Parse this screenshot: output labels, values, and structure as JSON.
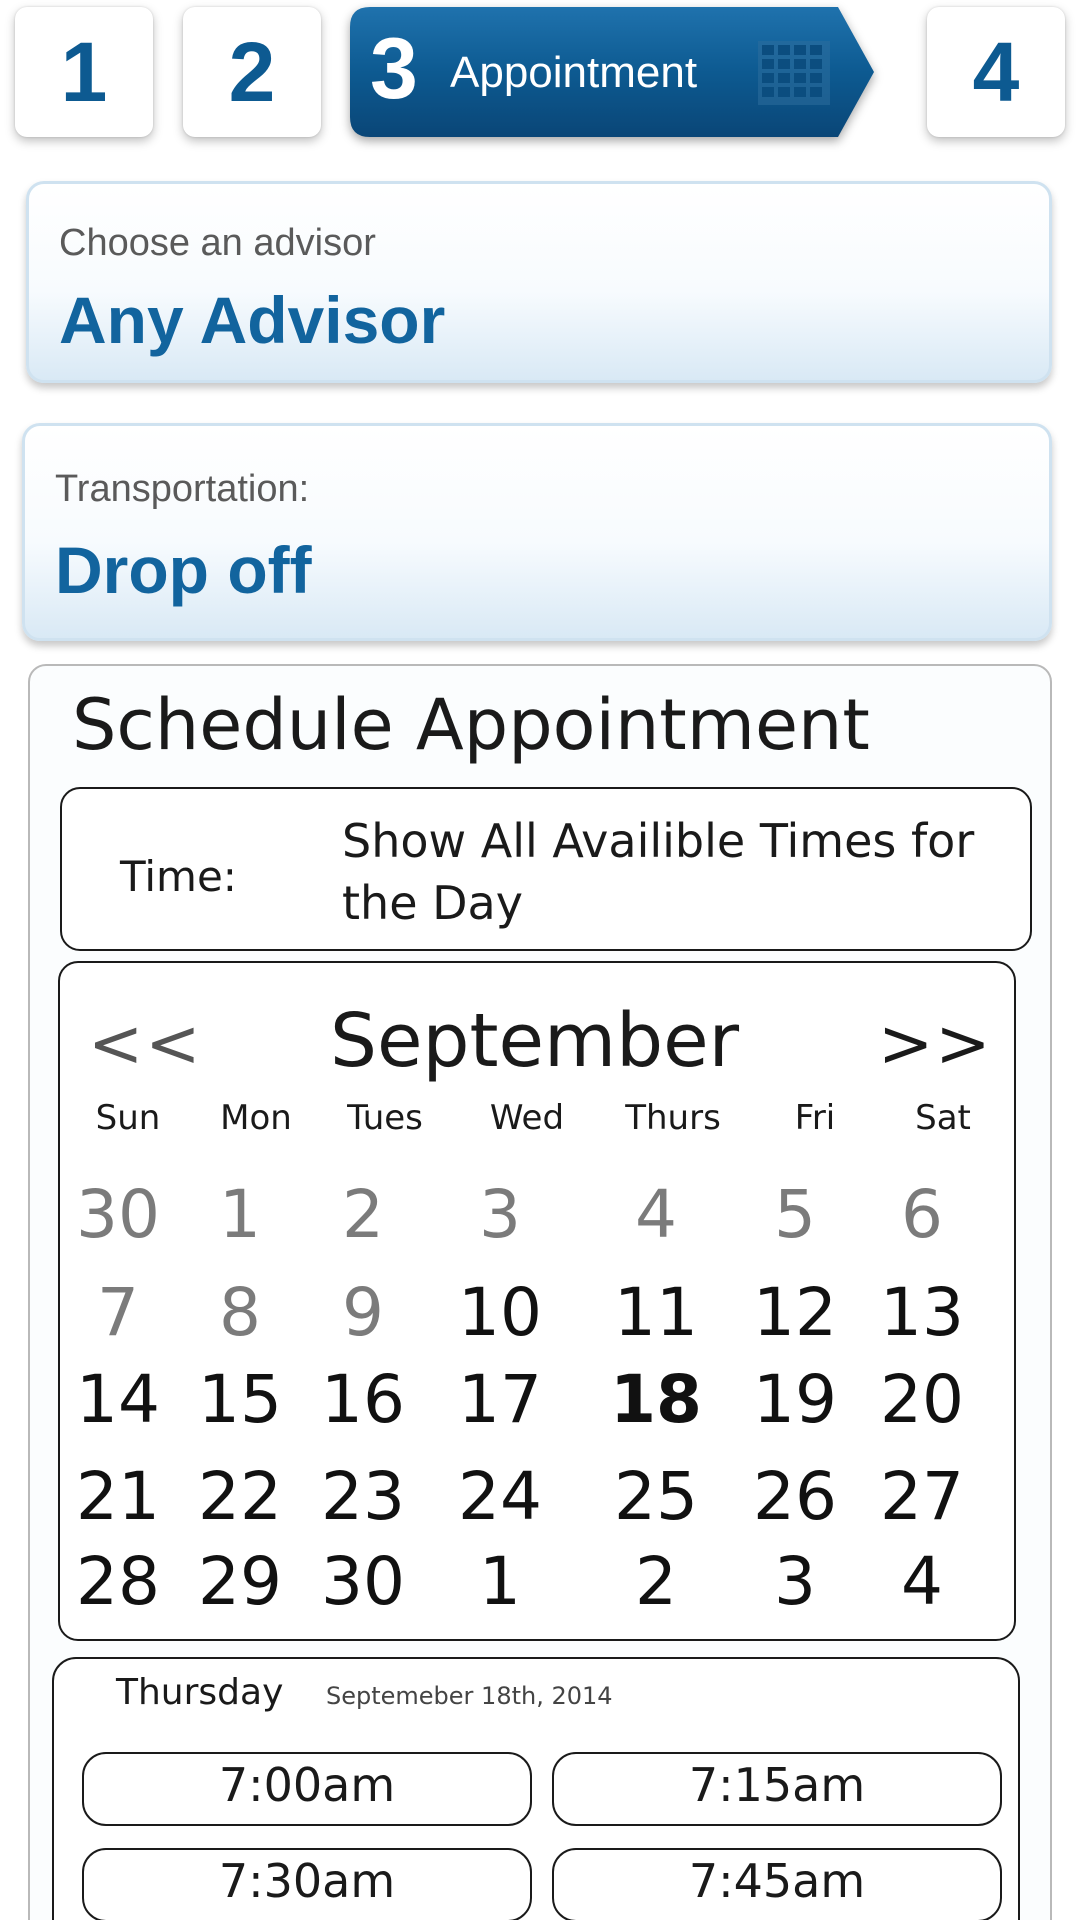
{
  "steps": {
    "step1": "1",
    "step2": "2",
    "active_number": "3",
    "active_label": "Appointment",
    "active_icon": "calendar-grid-icon",
    "step4": "4"
  },
  "colors": {
    "brand_blue": "#0d5a91",
    "brand_dark": "#0a4677",
    "panel_border": "#cfe2f0"
  },
  "advisor": {
    "caption": "Choose an advisor",
    "value": "Any Advisor"
  },
  "transport": {
    "caption": "Transportation:",
    "value": "Drop off"
  },
  "schedule": {
    "title": "Schedule Appointment",
    "time_label": "Time:",
    "time_value": "Show All Availible Times for the Day"
  },
  "calendar": {
    "prev": "<<",
    "next": ">>",
    "month": "September",
    "weekdays": [
      "Sun",
      "Mon",
      "Tues",
      "Wed",
      "Thurs",
      "Fri",
      "Sat"
    ],
    "weeks": [
      [
        "30",
        "1",
        "2",
        "3",
        "4",
        "5",
        "6"
      ],
      [
        "7",
        "8",
        "9",
        "10",
        "11",
        "12",
        "13"
      ],
      [
        "14",
        "15",
        "16",
        "17",
        "18",
        "19",
        "20"
      ],
      [
        "21",
        "22",
        "23",
        "24",
        "25",
        "26",
        "27"
      ],
      [
        "28",
        "29",
        "30",
        "1",
        "2",
        "3",
        "4"
      ]
    ],
    "unavailable": [
      [
        true,
        true,
        true,
        true,
        true,
        true,
        true
      ],
      [
        true,
        true,
        true,
        false,
        false,
        false,
        false
      ],
      [
        false,
        false,
        false,
        false,
        false,
        false,
        false
      ],
      [
        false,
        false,
        false,
        false,
        false,
        false,
        false
      ],
      [
        false,
        false,
        false,
        false,
        false,
        false,
        false
      ]
    ],
    "selected": "18"
  },
  "selection": {
    "day": "Thursday",
    "date": "Septemeber 18th, 2014",
    "slots": [
      "7:00am",
      "7:15am",
      "7:30am",
      "7:45am"
    ]
  }
}
